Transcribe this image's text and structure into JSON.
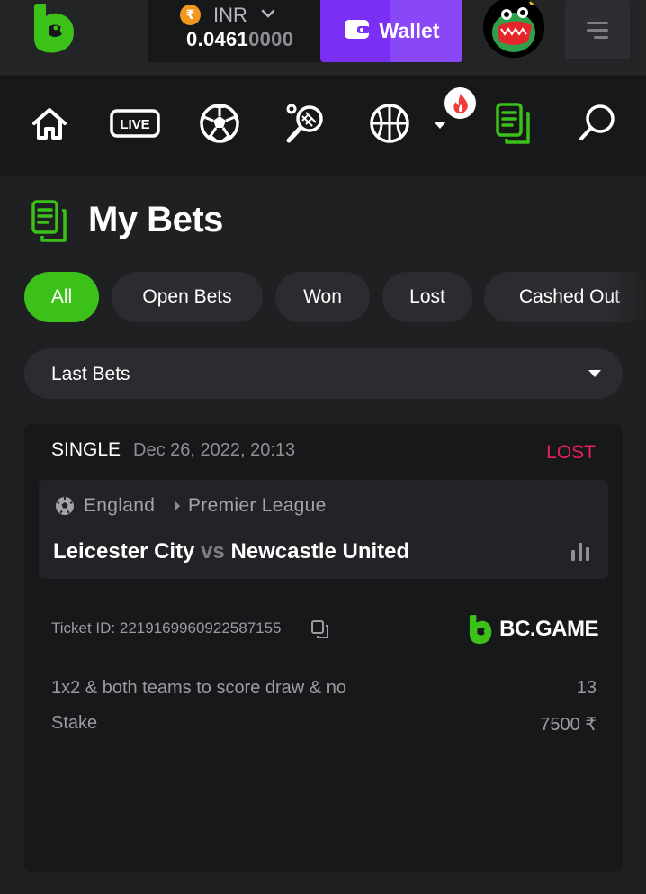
{
  "header": {
    "currency": "INR",
    "currency_symbol": "₹",
    "balance_main": "0.0461",
    "balance_dim": "0000",
    "wallet_label": "Wallet"
  },
  "nav": {
    "items": [
      "home",
      "live",
      "soccer",
      "tennis",
      "basketball",
      "more",
      "my-bets",
      "search"
    ],
    "live_label": "LIVE"
  },
  "page": {
    "title": "My Bets"
  },
  "filters": [
    {
      "label": "All",
      "active": true
    },
    {
      "label": "Open Bets",
      "active": false
    },
    {
      "label": "Won",
      "active": false
    },
    {
      "label": "Lost",
      "active": false
    },
    {
      "label": "Cashed Out",
      "active": false
    }
  ],
  "dropdown": {
    "selected": "Last Bets"
  },
  "bet": {
    "type": "SINGLE",
    "date": "Dec 26, 2022, 20:13",
    "status": "LOST",
    "country": "England",
    "league": "Premier League",
    "home_team": "Leicester City",
    "vs": "vs",
    "away_team": "Newcastle United",
    "ticket_label": "Ticket ID: 2219169960922587155",
    "brand": "BC.GAME",
    "market": "1x2 & both teams to score draw & no",
    "odds": "13",
    "stake_label": "Stake",
    "stake_value": "7500 ₹"
  },
  "colors": {
    "accent_green": "#3bc117",
    "wallet_purple": "#7b2ff5",
    "lost_pink": "#ed1d63"
  }
}
